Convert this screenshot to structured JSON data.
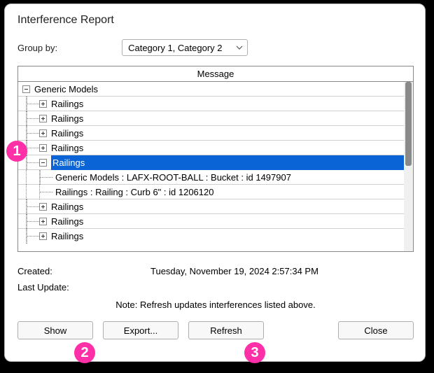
{
  "window": {
    "title": "Interference Report"
  },
  "group": {
    "label": "Group by:",
    "selected": "Category 1, Category 2"
  },
  "table": {
    "header": "Message",
    "nodes": [
      {
        "kind": "parent",
        "expanded": true,
        "level": 0,
        "label": "Generic Models",
        "selected": false
      },
      {
        "kind": "parent",
        "expanded": false,
        "level": 1,
        "label": "Railings",
        "selected": false
      },
      {
        "kind": "parent",
        "expanded": false,
        "level": 1,
        "label": "Railings",
        "selected": false
      },
      {
        "kind": "parent",
        "expanded": false,
        "level": 1,
        "label": "Railings",
        "selected": false
      },
      {
        "kind": "parent",
        "expanded": false,
        "level": 1,
        "label": "Railings",
        "selected": false
      },
      {
        "kind": "parent",
        "expanded": true,
        "level": 1,
        "label": "Railings",
        "selected": true
      },
      {
        "kind": "leaf",
        "level": 2,
        "label": "Generic Models : LAFX-ROOT-BALL : Bucket : id 1497907"
      },
      {
        "kind": "leaf",
        "level": 2,
        "label": "Railings : Railing : Curb 6\" : id 1206120"
      },
      {
        "kind": "parent",
        "expanded": false,
        "level": 1,
        "label": "Railings",
        "selected": false
      },
      {
        "kind": "parent",
        "expanded": false,
        "level": 1,
        "label": "Railings",
        "selected": false
      },
      {
        "kind": "parent",
        "expanded": false,
        "level": 1,
        "label": "Railings",
        "selected": false
      }
    ]
  },
  "meta": {
    "created_label": "Created:",
    "created_value": "Tuesday, November 19, 2024 2:57:34 PM",
    "last_update_label": "Last Update:",
    "last_update_value": "",
    "note": "Note: Refresh updates interferences listed above."
  },
  "buttons": {
    "show": "Show",
    "export": "Export...",
    "refresh": "Refresh",
    "close": "Close"
  },
  "annotations": {
    "n1": "1",
    "n2": "2",
    "n3": "3"
  }
}
